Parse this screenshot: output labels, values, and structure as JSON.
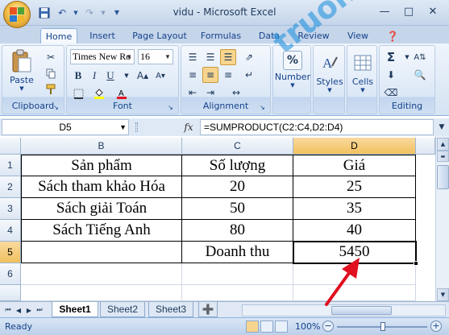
{
  "window": {
    "title": "vidu - Microsoft Excel",
    "controls": {
      "minimize": "—",
      "maximize": "□",
      "close": "✕"
    }
  },
  "quick_access": [
    "save-icon",
    "undo-icon",
    "redo-icon",
    "customize-icon"
  ],
  "tabs": [
    "Home",
    "Insert",
    "Page Layout",
    "Formulas",
    "Data",
    "Review",
    "View"
  ],
  "active_tab": "Home",
  "ribbon": {
    "clipboard": {
      "label": "Clipboard",
      "paste": "Paste"
    },
    "font": {
      "label": "Font",
      "font_name": "Times New Ro",
      "font_size": "16",
      "bold": "B",
      "italic": "I",
      "underline": "U"
    },
    "alignment": {
      "label": "Alignment"
    },
    "number": {
      "label": "Number",
      "symbol": "%"
    },
    "styles": {
      "label": "Styles"
    },
    "cells": {
      "label": "Cells"
    },
    "editing": {
      "label": "Editing",
      "sum_symbol": "Σ"
    }
  },
  "formula_bar": {
    "name_box": "D5",
    "fx": "fx",
    "formula": "=SUMPRODUCT(C2:C4,D2:D4)"
  },
  "sheet": {
    "columns": [
      "B",
      "C",
      "D"
    ],
    "rows": [
      "1",
      "2",
      "3",
      "4",
      "5",
      "6"
    ],
    "cells": [
      [
        "Sản phẩm",
        "Số lượng",
        "Giá"
      ],
      [
        "Sách tham khảo Hóa",
        "20",
        "25"
      ],
      [
        "Sách giải Toán",
        "50",
        "35"
      ],
      [
        "Sách Tiếng Anh",
        "80",
        "40"
      ],
      [
        "",
        "Doanh thu",
        "5450"
      ],
      [
        "",
        "",
        ""
      ]
    ],
    "selected_column": "D",
    "selected_row": "5"
  },
  "sheet_tabs": [
    "Sheet1",
    "Sheet2",
    "Sheet3"
  ],
  "active_sheet": "Sheet1",
  "status": {
    "ready": "Ready",
    "zoom": "100%",
    "zoom_minus": "−",
    "zoom_plus": "+"
  },
  "watermark": "truongtin.top",
  "colors": {
    "accent": "#15428b",
    "selected_header": "#f1c15f",
    "arrow": "#e01020",
    "watermark": "#148cdc"
  }
}
